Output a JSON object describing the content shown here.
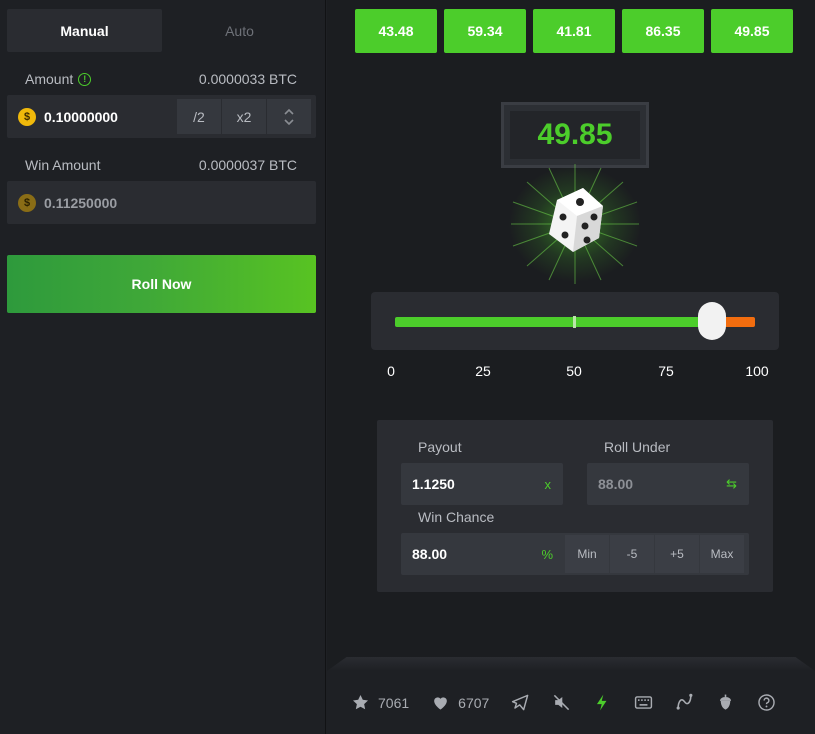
{
  "left": {
    "tabs": [
      {
        "label": "Manual"
      },
      {
        "label": "Auto"
      }
    ],
    "amount": {
      "label": "Amount",
      "info": "!",
      "btc_value": "0.0000033 BTC",
      "value": "0.10000000",
      "coin": "$",
      "half_label": "/2",
      "double_label": "x2",
      "up": "^",
      "down": "v"
    },
    "win_amount": {
      "label": "Win Amount",
      "btc_value": "0.0000037 BTC",
      "value": "0.11250000",
      "coin": "$"
    },
    "roll_label": "Roll Now"
  },
  "right": {
    "history": [
      "43.48",
      "59.34",
      "41.81",
      "86.35",
      "49.85"
    ],
    "result": "49.85",
    "slider": {
      "min": 0,
      "max": 100,
      "value": 88,
      "ticks": [
        "0",
        "25",
        "50",
        "75",
        "100"
      ]
    },
    "payout": {
      "label": "Payout",
      "value": "1.1250",
      "suffix": "x"
    },
    "roll_under": {
      "label": "Roll Under",
      "value": "88.00",
      "suffix": "⇆"
    },
    "win_chance": {
      "label": "Win Chance",
      "value": "88.00",
      "suffix": "%",
      "buttons": [
        "Min",
        "-5",
        "+5",
        "Max"
      ]
    },
    "footer": {
      "stars": "7061",
      "likes": "6707"
    }
  },
  "colors": {
    "accent": "#4ccd2b",
    "orange": "#f26d0f",
    "coin": "#f0b90b"
  }
}
